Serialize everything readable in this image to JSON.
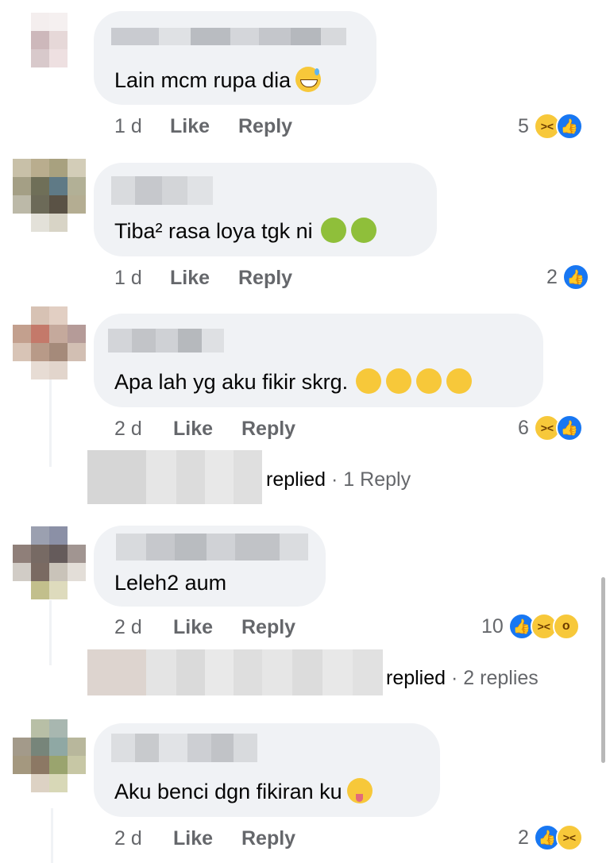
{
  "comments": [
    {
      "text": "Lain mcm rupa dia",
      "emojis": [
        "sweat-smile"
      ],
      "time": "1 d",
      "like": "Like",
      "reply": "Reply",
      "reaction_count": "5",
      "reactions": [
        "haha",
        "like"
      ]
    },
    {
      "text": "Tiba² rasa loya tgk ni",
      "emojis": [
        "nauseated",
        "nauseated"
      ],
      "time": "1 d",
      "like": "Like",
      "reply": "Reply",
      "reaction_count": "2",
      "reactions": [
        "like"
      ]
    },
    {
      "text": "Apa lah yg aku fikir skrg.",
      "emojis": [
        "rofl",
        "rofl",
        "rofl",
        "rofl"
      ],
      "time": "2 d",
      "like": "Like",
      "reply": "Reply",
      "reaction_count": "6",
      "reactions": [
        "haha",
        "like"
      ],
      "thread": {
        "replied": "replied",
        "sep": "·",
        "count": "1 Reply"
      }
    },
    {
      "text": "Leleh2 aum",
      "emojis": [],
      "time": "2 d",
      "like": "Like",
      "reply": "Reply",
      "reaction_count": "10",
      "reactions": [
        "like",
        "haha",
        "wow"
      ],
      "thread": {
        "replied": "replied",
        "sep": "·",
        "count": "2 replies"
      }
    },
    {
      "text": "Aku benci dgn fikiran ku",
      "emojis": [
        "zany"
      ],
      "time": "2 d",
      "like": "Like",
      "reply": "Reply",
      "reaction_count": "2",
      "reactions": [
        "like",
        "haha"
      ]
    }
  ],
  "colors": {
    "bubble": "#f0f2f5",
    "meta": "#65676b",
    "like_blue": "#1877f2",
    "emoji_yellow": "#f7c83a"
  }
}
